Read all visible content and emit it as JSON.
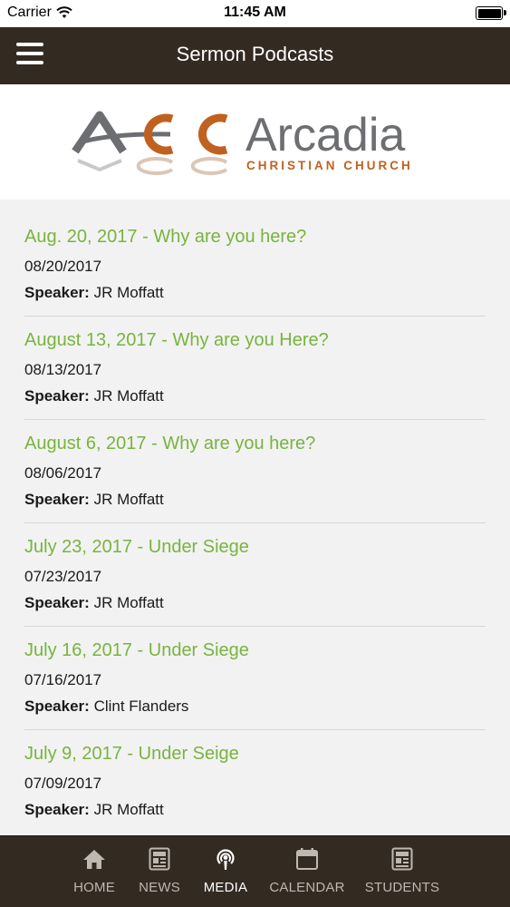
{
  "status_bar": {
    "carrier": "Carrier",
    "time": "11:45 AM"
  },
  "navbar": {
    "title": "Sermon Podcasts",
    "menu_icon": "hamburger-menu-icon"
  },
  "logo": {
    "mark": "ACC",
    "name": "Arcadia",
    "subtitle": "CHRISTIAN CHURCH",
    "colors": {
      "gray": "#6d6e71",
      "orange": "#c0611f"
    }
  },
  "speaker_label": "Speaker:",
  "sermons": [
    {
      "title": "Aug. 20, 2017 - Why are you here?",
      "date": "08/20/2017",
      "speaker": "JR Moffatt"
    },
    {
      "title": "August 13, 2017 - Why are you Here?",
      "date": "08/13/2017",
      "speaker": "JR Moffatt"
    },
    {
      "title": "August 6, 2017 - Why are you here?",
      "date": "08/06/2017",
      "speaker": "JR Moffatt"
    },
    {
      "title": "July 23, 2017 - Under Siege",
      "date": "07/23/2017",
      "speaker": "JR Moffatt"
    },
    {
      "title": "July 16, 2017 - Under Siege",
      "date": "07/16/2017",
      "speaker": "Clint Flanders"
    },
    {
      "title": "July 9, 2017 - Under Seige",
      "date": "07/09/2017",
      "speaker": "JR Moffatt"
    }
  ],
  "tabs": [
    {
      "label": "HOME",
      "icon": "home-icon",
      "active": false
    },
    {
      "label": "NEWS",
      "icon": "news-icon",
      "active": false
    },
    {
      "label": "MEDIA",
      "icon": "podcast-icon",
      "active": true
    },
    {
      "label": "CALENDAR",
      "icon": "calendar-icon",
      "active": false
    },
    {
      "label": "STUDENTS",
      "icon": "students-icon",
      "active": false
    }
  ],
  "colors": {
    "header_bg": "#332a22",
    "link_green": "#78b43e",
    "tab_inactive": "#bfb8b0",
    "tab_active": "#ffffff"
  }
}
